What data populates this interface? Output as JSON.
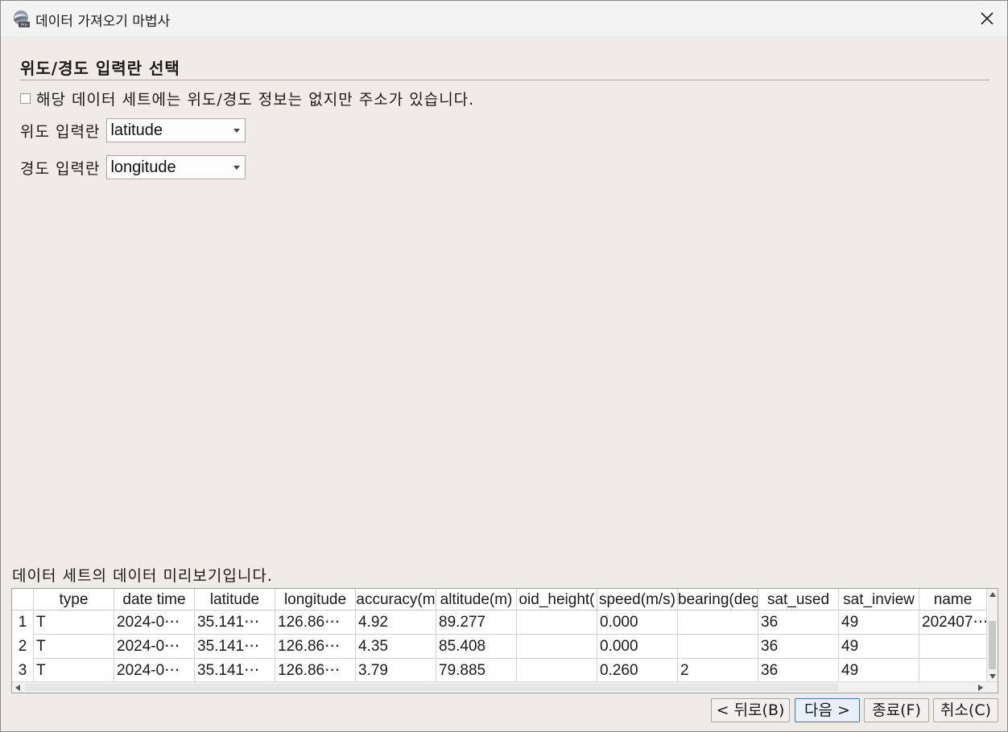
{
  "window": {
    "title": "데이터 가져오기 마법사",
    "app_icon": "arcgis-pro-icon",
    "close_icon": "close-icon"
  },
  "section": {
    "heading": "위도/경도 입력란 선택",
    "address_checkbox": {
      "label": "해당 데이터 세트에는 위도/경도 정보는 없지만 주소가 있습니다.",
      "checked": false
    }
  },
  "fields": {
    "latitude": {
      "label": "위도 입력란",
      "value": "latitude"
    },
    "longitude": {
      "label": "경도 입력란",
      "value": "longitude"
    }
  },
  "preview": {
    "label": "데이터 세트의 데이터 미리보기입니다.",
    "columns": [
      "type",
      "date time",
      "latitude",
      "longitude",
      "accuracy(m",
      "altitude(m)",
      "oid_height(",
      "speed(m/s)",
      "bearing(deg",
      "sat_used",
      "sat_inview",
      "name"
    ],
    "rows": [
      {
        "n": "1",
        "cells": [
          "T",
          "2024-0⋯",
          "35.141⋯",
          "126.86⋯",
          "4.92",
          "89.277",
          "",
          "0.000",
          "",
          "36",
          "49",
          "202407⋯"
        ]
      },
      {
        "n": "2",
        "cells": [
          "T",
          "2024-0⋯",
          "35.141⋯",
          "126.86⋯",
          "4.35",
          "85.408",
          "",
          "0.000",
          "",
          "36",
          "49",
          ""
        ]
      },
      {
        "n": "3",
        "cells": [
          "T",
          "2024-0⋯",
          "35.141⋯",
          "126.86⋯",
          "3.79",
          "79.885",
          "",
          "0.260",
          "2",
          "36",
          "49",
          ""
        ]
      }
    ]
  },
  "buttons": {
    "back": "< 뒤로(B)",
    "next": "다음 >",
    "finish": "종료(F)",
    "cancel": "취소(C)"
  }
}
